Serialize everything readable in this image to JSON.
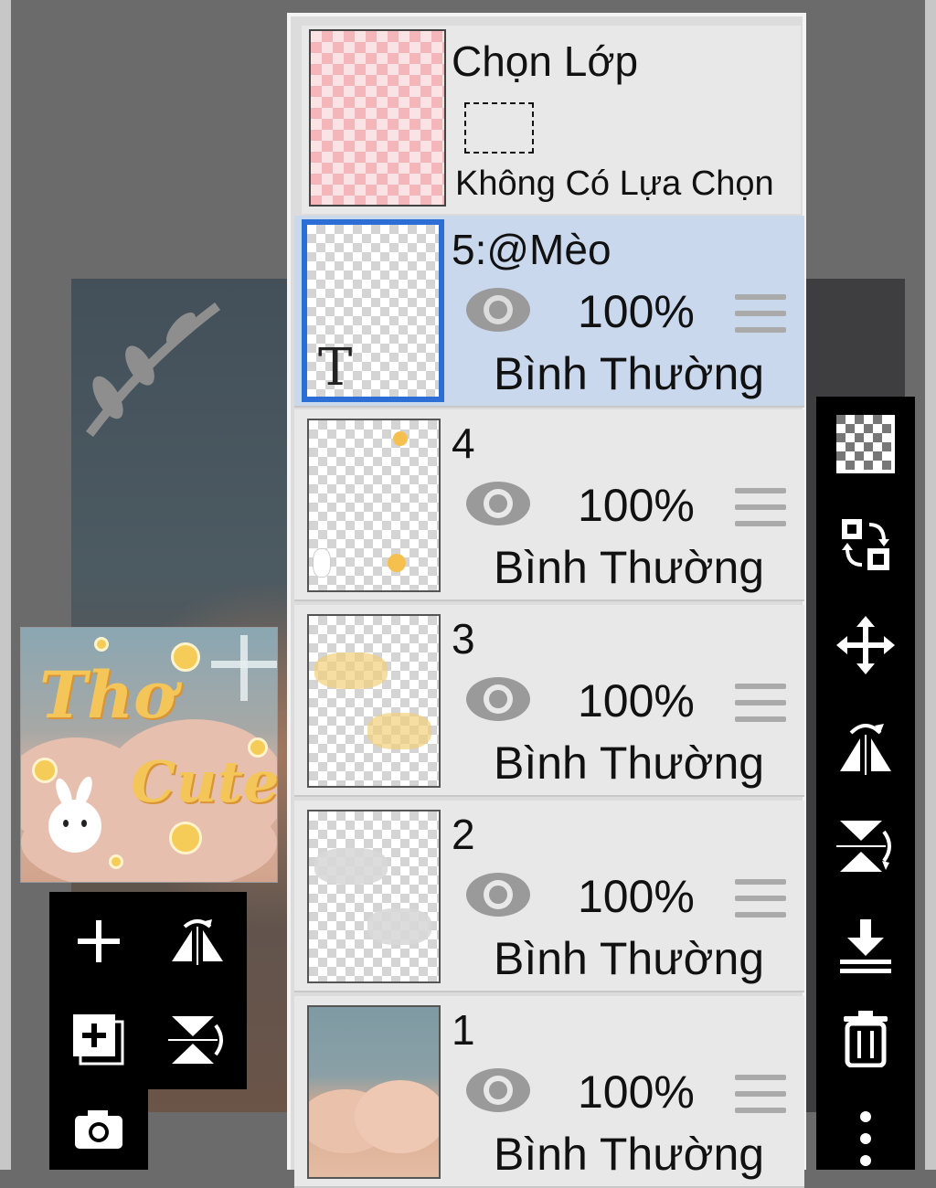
{
  "selection_layer": {
    "title": "Chọn Lớp",
    "status": "Không Có Lựa Chọn"
  },
  "layers": [
    {
      "name": "5:@Mèo",
      "opacity": "100%",
      "blend_mode": "Bình Thường",
      "selected": true,
      "type": "text",
      "thumb_glyph": "T"
    },
    {
      "name": "4",
      "opacity": "100%",
      "blend_mode": "Bình Thường",
      "selected": false
    },
    {
      "name": "3",
      "opacity": "100%",
      "blend_mode": "Bình Thường",
      "selected": false
    },
    {
      "name": "2",
      "opacity": "100%",
      "blend_mode": "Bình Thường",
      "selected": false
    },
    {
      "name": "1",
      "opacity": "100%",
      "blend_mode": "Bình Thường",
      "selected": false
    }
  ],
  "preview": {
    "title_line1": "Thơ",
    "title_line2": "Cute"
  },
  "left_toolbar": [
    "plus-icon",
    "flip-horizontal-icon",
    "add-layer-icon",
    "flip-vertical-icon",
    "camera-icon"
  ],
  "right_toolbar": [
    "transparency-icon",
    "swap-layers-icon",
    "move-icon",
    "flip-horizontal-icon",
    "flip-vertical-icon",
    "merge-down-icon",
    "trash-icon",
    "more-icon"
  ],
  "colors": {
    "selected_row": "#cad8ee",
    "selected_border": "#2b6fd6",
    "toolbar_bg": "#000000"
  }
}
